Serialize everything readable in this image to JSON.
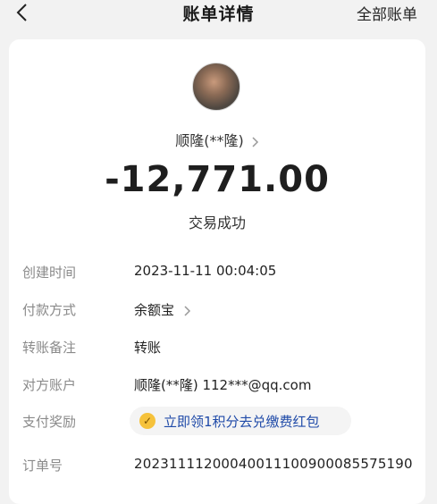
{
  "header": {
    "title": "账单详情",
    "right_link": "全部账单",
    "back_icon": "chevron-left-icon"
  },
  "transaction": {
    "payee_name": "顺隆(**隆)",
    "amount": "-12,771.00",
    "status": "交易成功"
  },
  "details": {
    "created_time": {
      "label": "创建时间",
      "value": "2023-11-11 00:04:05"
    },
    "payment_method": {
      "label": "付款方式",
      "value": "余额宝"
    },
    "transfer_note": {
      "label": "转账备注",
      "value": "转账"
    },
    "counterparty": {
      "label": "对方账户",
      "value": "顺隆(**隆) 112***@qq.com"
    },
    "reward": {
      "label": "支付奖励",
      "value": "立即领1积分去兑缴费红包"
    },
    "order_no": {
      "label": "订单号",
      "value": "20231111200040011100900085575190"
    }
  },
  "colors": {
    "background": "#f2f2f2",
    "card": "#ffffff",
    "label": "#8a8a8a",
    "reward_text": "#1f4aa8",
    "coin": "#f6c23b"
  }
}
